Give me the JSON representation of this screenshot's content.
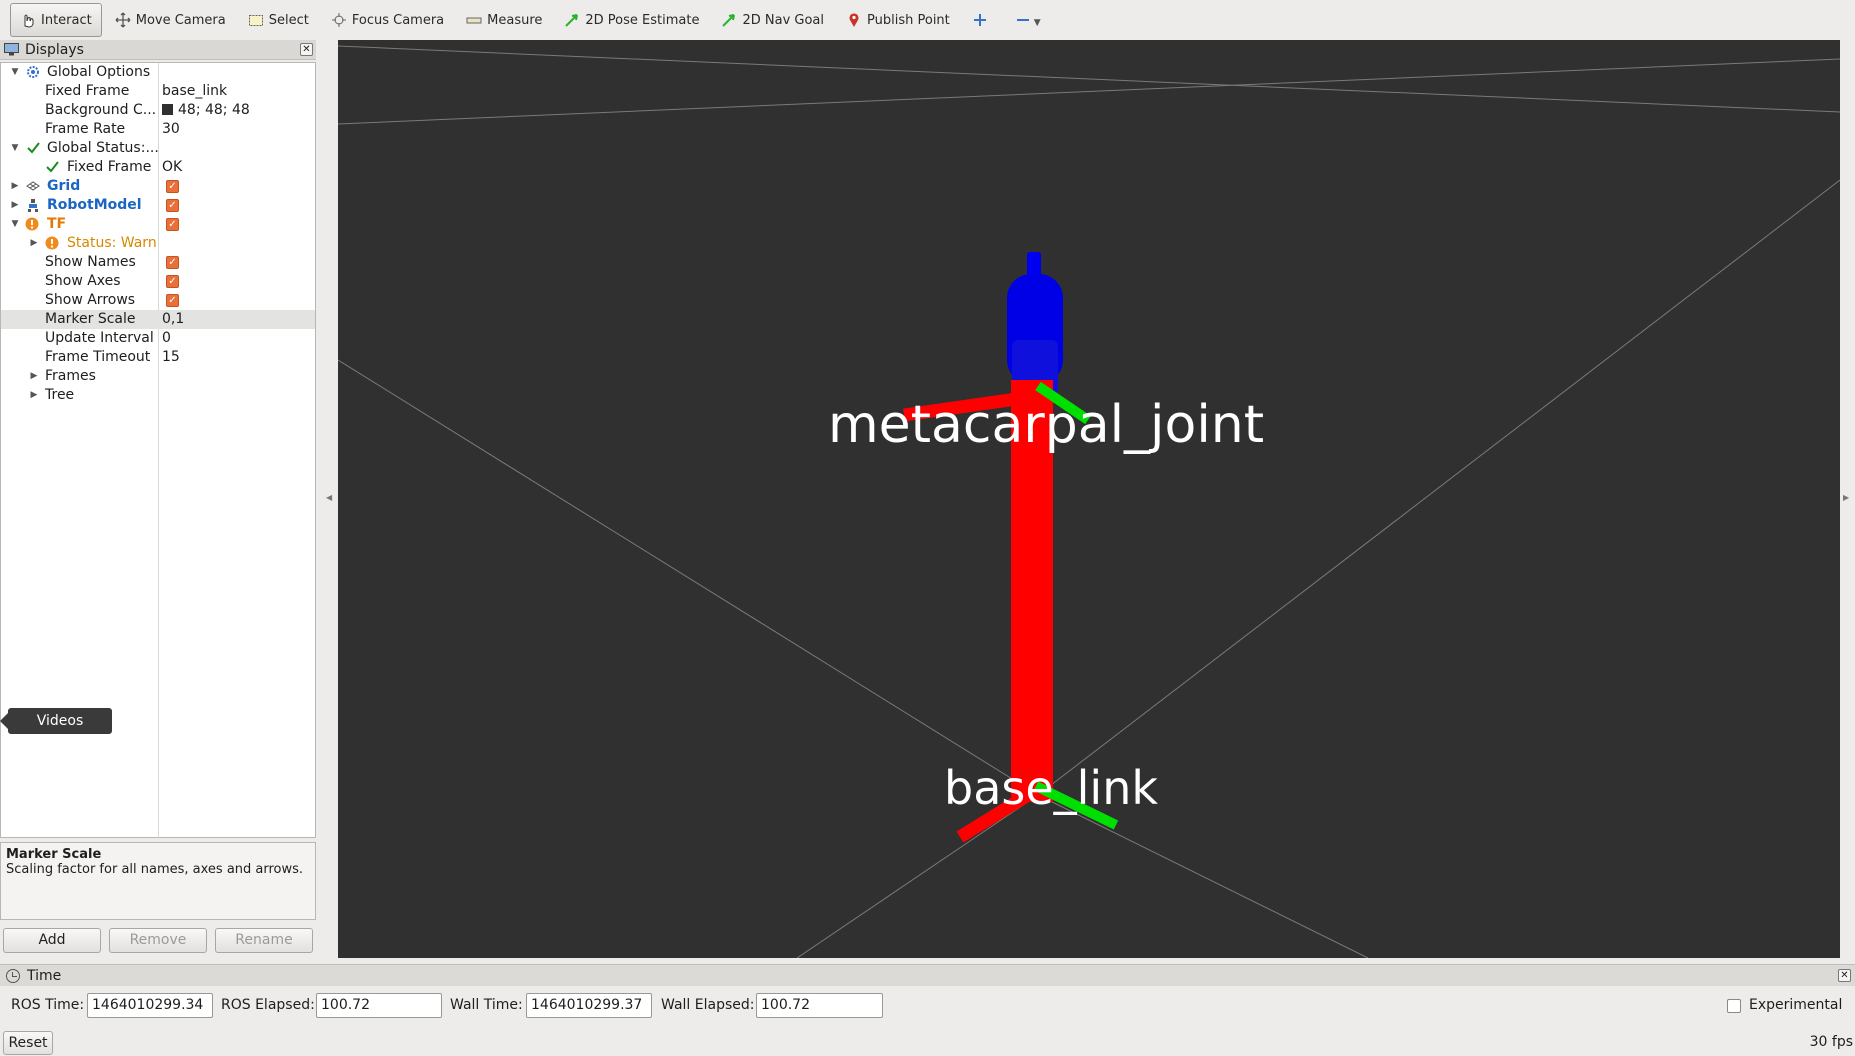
{
  "toolbar": {
    "tools": [
      {
        "label": "Interact",
        "icon": "cursor-hand-icon"
      },
      {
        "label": "Move Camera",
        "icon": "move-arrows-icon"
      },
      {
        "label": "Select",
        "icon": "select-box-icon"
      },
      {
        "label": "Focus Camera",
        "icon": "focus-target-icon"
      },
      {
        "label": "Measure",
        "icon": "ruler-icon"
      },
      {
        "label": "2D Pose Estimate",
        "icon": "green-arrow-icon"
      },
      {
        "label": "2D Nav Goal",
        "icon": "green-arrow-icon"
      },
      {
        "label": "Publish Point",
        "icon": "map-pin-icon"
      }
    ]
  },
  "displays": {
    "title": "Displays",
    "rows": [
      {
        "label": "Global Options",
        "value": ""
      },
      {
        "label": "Fixed Frame",
        "value": "base_link"
      },
      {
        "label": "Background C...",
        "value": "48; 48; 48"
      },
      {
        "label": "Frame Rate",
        "value": "30"
      },
      {
        "label": "Global Status:...",
        "value": ""
      },
      {
        "label": "Fixed Frame",
        "value": "OK"
      },
      {
        "label": "Grid",
        "value": ""
      },
      {
        "label": "RobotModel",
        "value": ""
      },
      {
        "label": "TF",
        "value": ""
      },
      {
        "label": "Status: Warn",
        "value": ""
      },
      {
        "label": "Show Names",
        "value": ""
      },
      {
        "label": "Show Axes",
        "value": ""
      },
      {
        "label": "Show Arrows",
        "value": ""
      },
      {
        "label": "Marker Scale",
        "value": "0,1"
      },
      {
        "label": "Update Interval",
        "value": "0"
      },
      {
        "label": "Frame Timeout",
        "value": "15"
      },
      {
        "label": "Frames",
        "value": ""
      },
      {
        "label": "Tree",
        "value": ""
      }
    ],
    "checked": {
      "grid": true,
      "robot_model": true,
      "tf": true,
      "show_names": true,
      "show_axes": true,
      "show_arrows": true
    },
    "tooltip": "Videos"
  },
  "description": {
    "title": "Marker Scale",
    "text": "Scaling factor for all names, axes and arrows."
  },
  "buttons": {
    "add": "Add",
    "remove": "Remove",
    "rename": "Rename"
  },
  "viewport": {
    "background": "#303030",
    "labels": {
      "upper_frame": "metacarpal_joint",
      "lower_frame": "base_link"
    }
  },
  "time": {
    "title": "Time",
    "ros_time_label": "ROS Time:",
    "ros_time": "1464010299.34",
    "ros_elapsed_label": "ROS Elapsed:",
    "ros_elapsed": "100.72",
    "wall_time_label": "Wall Time:",
    "wall_time": "1464010299.37",
    "wall_elapsed_label": "Wall Elapsed:",
    "wall_elapsed": "100.72",
    "experimental_label": "Experimental",
    "experimental_checked": false
  },
  "status": {
    "reset": "Reset",
    "fps": "30 fps"
  },
  "colors": {
    "x_axis": "#ff0000",
    "y_axis": "#00e000",
    "z_axis": "#0000ff",
    "checkbox": "#e9703a",
    "link_blue": "#1b66c0",
    "warn_orange": "#e07a00"
  }
}
